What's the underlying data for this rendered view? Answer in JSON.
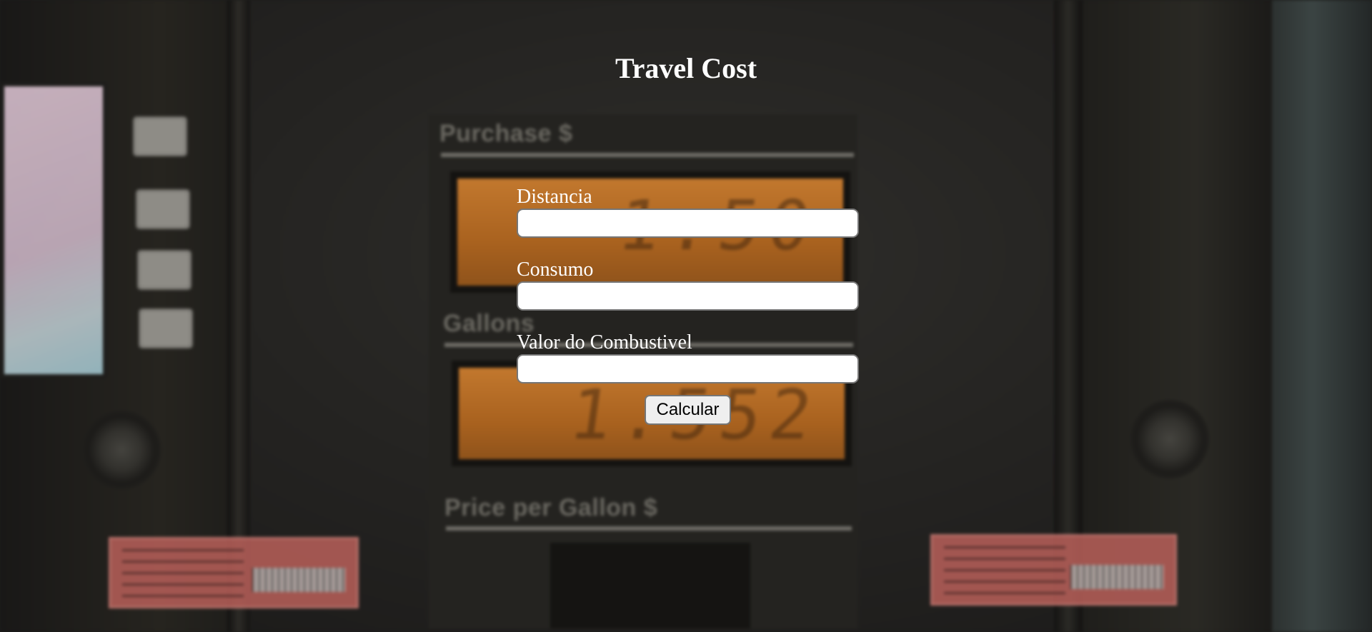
{
  "page": {
    "title": "Travel Cost"
  },
  "form": {
    "distance": {
      "label": "Distancia",
      "value": "",
      "placeholder": ""
    },
    "consumption": {
      "label": "Consumo",
      "value": "",
      "placeholder": ""
    },
    "fuel_price": {
      "label": "Valor do Combustivel",
      "value": "",
      "placeholder": ""
    },
    "submit_label": "Calcular"
  },
  "background": {
    "description_labels": {
      "purchase": "Purchase $",
      "gallons": "Gallons",
      "price_per_gallon": "Price per Gallon $"
    },
    "display_purchase": "1.50",
    "display_gallons": "1.552"
  }
}
